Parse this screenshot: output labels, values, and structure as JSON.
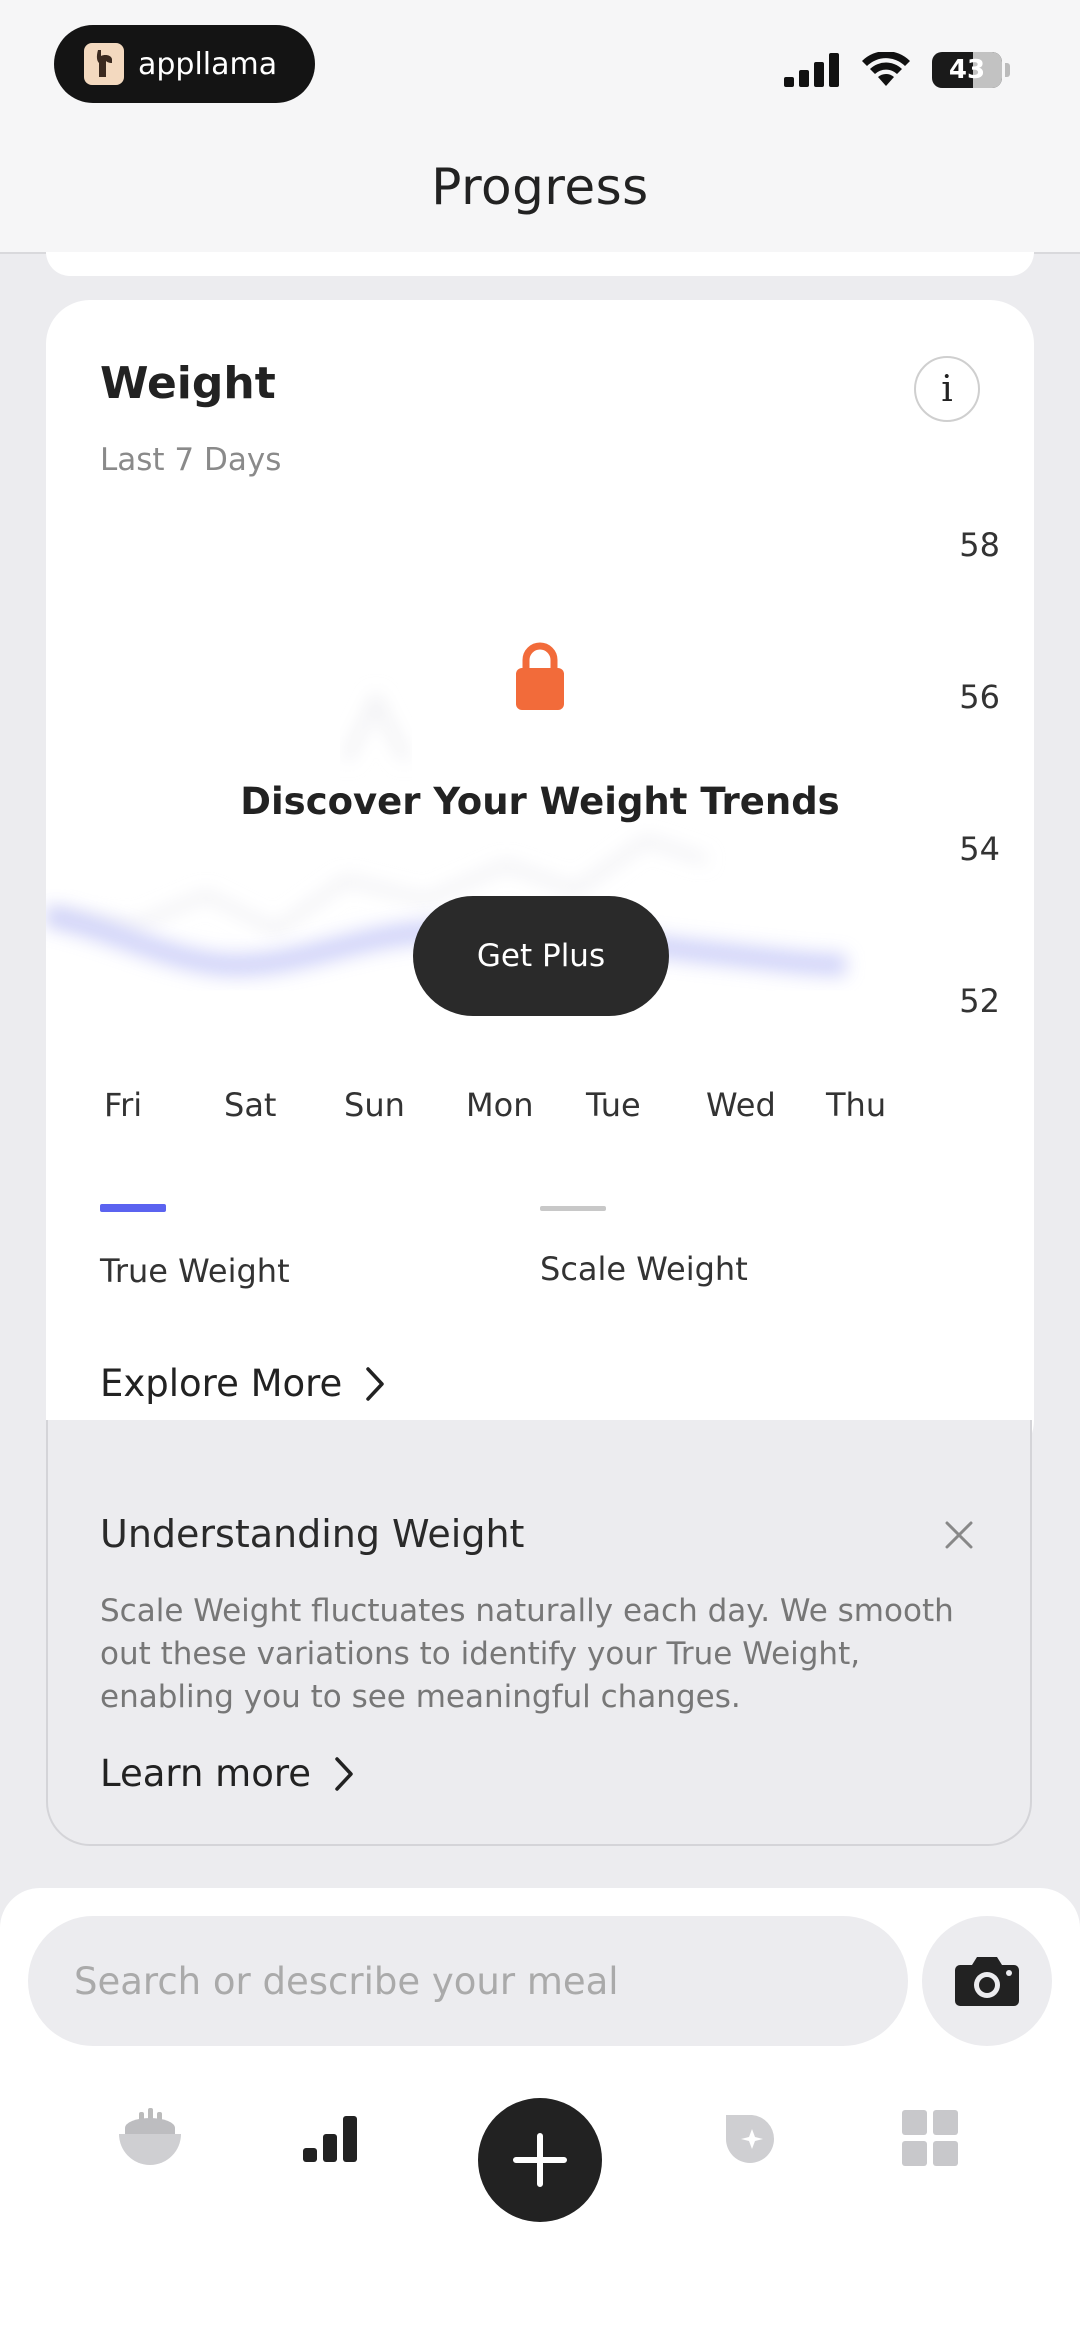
{
  "status_bar": {
    "app_name": "appllama",
    "battery": "43"
  },
  "header": {
    "title": "Progress"
  },
  "weight_card": {
    "title": "Weight",
    "subtitle": "Last 7 Days",
    "info_label": "i",
    "y_axis": [
      "58",
      "56",
      "54",
      "52"
    ],
    "locked_message": "Discover Your Weight Trends",
    "cta_label": "Get Plus",
    "days": [
      "Fri",
      "Sat",
      "Sun",
      "Mon",
      "Tue",
      "Wed",
      "Thu"
    ],
    "legend": [
      {
        "label": "True Weight",
        "color": "#5b63f0"
      },
      {
        "label": "Scale Weight",
        "color": "#c8c8c8"
      }
    ],
    "explore_label": "Explore More"
  },
  "understanding_card": {
    "title": "Understanding Weight",
    "body": "Scale Weight fluctuates naturally each day. We smooth out these variations to identify your True Weight, enabling you to see meaningful changes.",
    "learn_more_label": "Learn more"
  },
  "bottom": {
    "search_placeholder": "Search or describe your meal",
    "tabs": [
      "meal-bowl-icon",
      "progress-bars-icon",
      "add-icon",
      "badge-icon",
      "grid-icon"
    ]
  },
  "colors": {
    "accent": "#5b63f0",
    "lock": "#f26b3a",
    "dark": "#222222"
  }
}
